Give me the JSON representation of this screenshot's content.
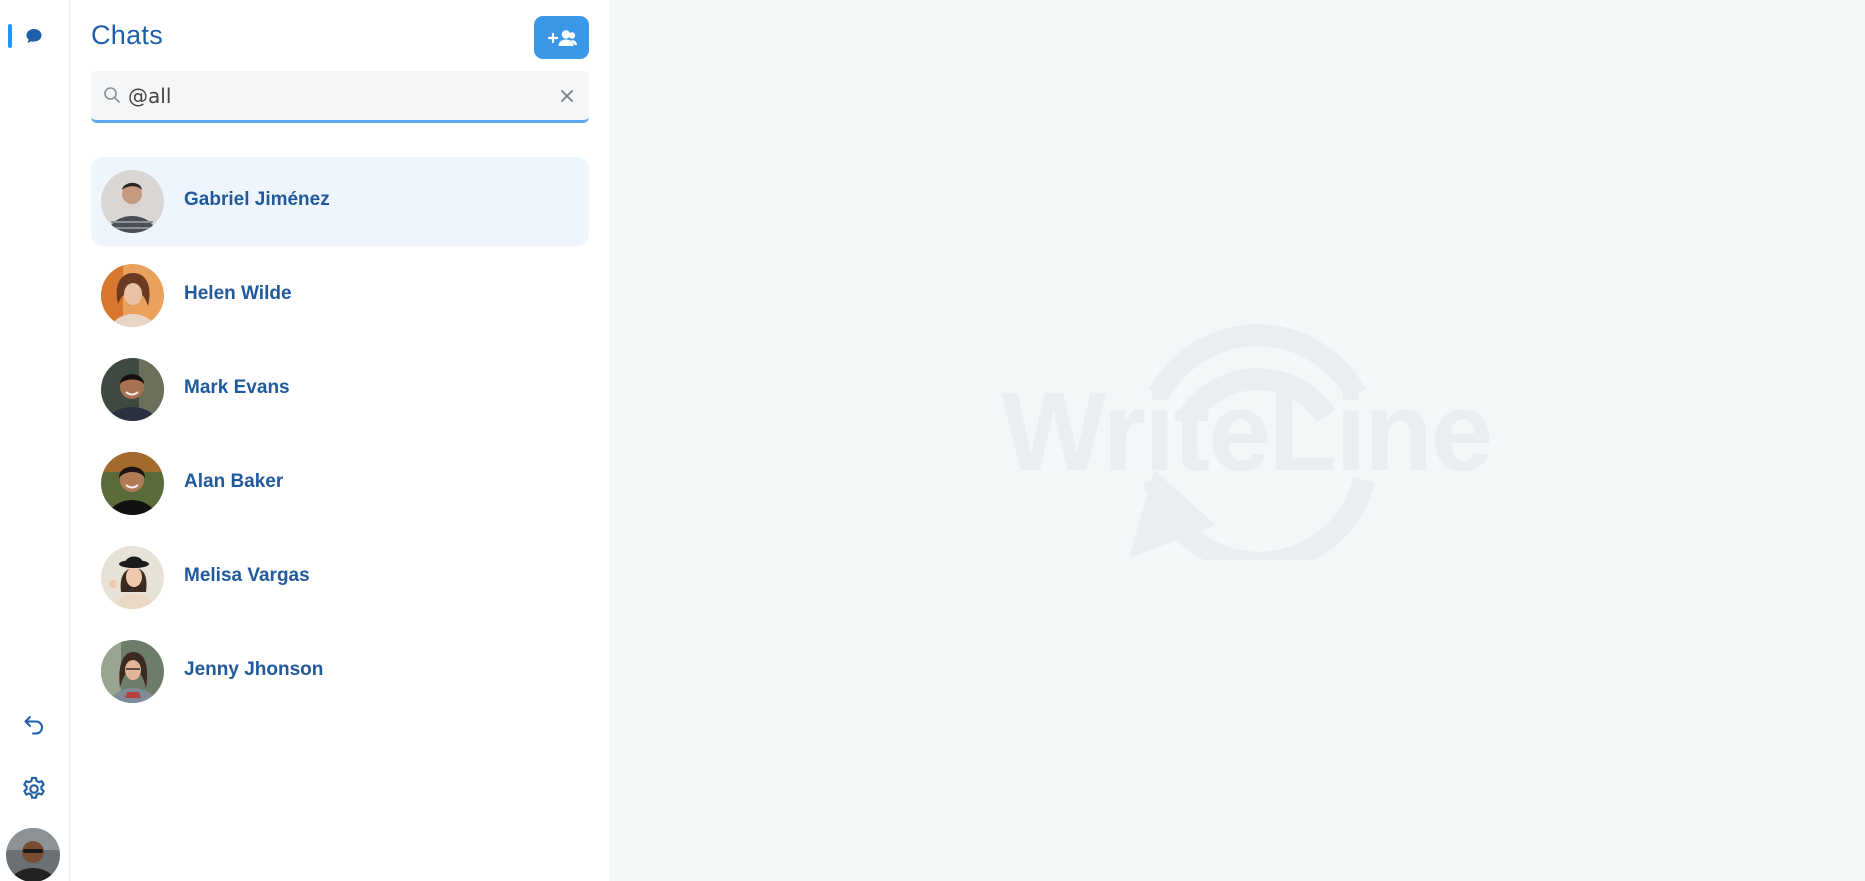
{
  "sidebar": {
    "nav": [
      {
        "id": "chats",
        "icon": "chat-bubble-icon",
        "active": true
      },
      {
        "id": "back",
        "icon": "undo-icon"
      },
      {
        "id": "settings",
        "icon": "gear-icon"
      }
    ],
    "profile_avatar": "user-avatar"
  },
  "chat_list": {
    "title": "Chats",
    "add_button_icon": "add-user-icon",
    "search": {
      "value": "@all",
      "icon": "search-icon",
      "clear_icon": "close-icon"
    },
    "contacts": [
      {
        "name": "Gabriel Jiménez",
        "active": true
      },
      {
        "name": "Helen Wilde",
        "active": false
      },
      {
        "name": "Mark Evans",
        "active": false
      },
      {
        "name": "Alan Baker",
        "active": false
      },
      {
        "name": "Melisa Vargas",
        "active": false
      },
      {
        "name": "Jenny Jhonson",
        "active": false
      }
    ]
  },
  "main": {
    "watermark_text": "WriteLine"
  },
  "colors": {
    "accent": "#3b97e8",
    "indicator": "#2196f3",
    "name_text": "#215a9c",
    "title_text": "#1e5fa8",
    "active_row_bg": "#eef5fd",
    "main_bg": "#f4f7f8",
    "watermark": "#ebeef0"
  }
}
